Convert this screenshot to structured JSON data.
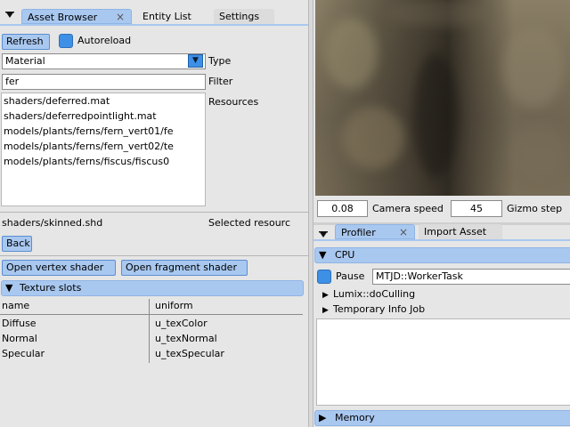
{
  "asset_browser": {
    "tabs": [
      "Asset Browser",
      "Entity List",
      "Settings"
    ],
    "close_glyph": "×",
    "refresh_label": "Refresh",
    "autoreload_label": "Autoreload",
    "type_value": "Material",
    "type_label": "Type",
    "filter_value": "fer",
    "filter_label": "Filter",
    "resources_label": "Resources",
    "resources": [
      "shaders/deferred.mat",
      "shaders/deferredpointlight.mat",
      "models/plants/ferns/fern_vert01/fe",
      "models/plants/ferns/fern_vert02/te",
      "models/plants/ferns/fiscus/fiscus0"
    ],
    "selected_value": "shaders/skinned.shd",
    "selected_label": "Selected resourc",
    "back_label": "Back",
    "open_vertex_label": "Open vertex shader",
    "open_fragment_label": "Open fragment shader",
    "texture_slots_label": "Texture slots",
    "texture_table": {
      "headers": [
        "name",
        "uniform"
      ],
      "rows": [
        [
          "Diffuse",
          "u_texColor"
        ],
        [
          "Normal",
          "u_texNormal"
        ],
        [
          "Specular",
          "u_texSpecular"
        ]
      ]
    }
  },
  "scene_view": {
    "camera_speed_value": "0.08",
    "camera_speed_label": "Camera speed",
    "gizmo_step_value": "45",
    "gizmo_step_label": "Gizmo step"
  },
  "profiler": {
    "tabs": [
      "Profiler",
      "Import Asset"
    ],
    "cpu_label": "CPU",
    "pause_label": "Pause",
    "thread_value": "MTJD::WorkerTask",
    "tree": [
      "Lumix::doCulling",
      "Temporary Info Job"
    ],
    "memory_label": "Memory"
  },
  "colors": {
    "accent": "#a9c8f0",
    "checkbox": "#3e8fe6"
  }
}
